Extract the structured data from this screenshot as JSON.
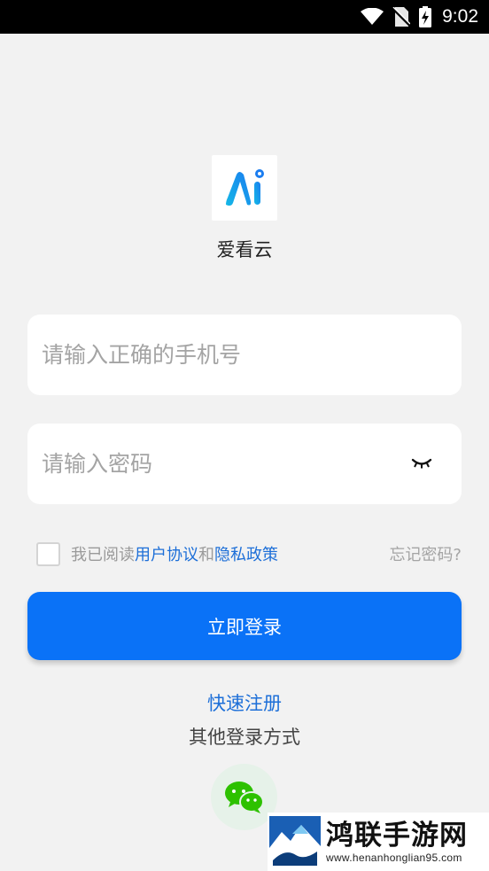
{
  "status_bar": {
    "time": "9:02",
    "icons": [
      "wifi-icon",
      "no-sim-icon",
      "battery-charging-icon"
    ]
  },
  "app": {
    "logo_icon": "ai-logo-icon",
    "name": "爱看云"
  },
  "phone_field": {
    "value": "",
    "placeholder": "请输入正确的手机号"
  },
  "password_field": {
    "value": "",
    "placeholder": "请输入密码",
    "toggle_icon": "eye-closed-icon"
  },
  "agreement": {
    "checked": false,
    "prefix": "我已阅读",
    "user_agreement": "用户协议",
    "conjunction": "和",
    "privacy_policy": "隐私政策",
    "forgot_password": "忘记密码?"
  },
  "login_button": {
    "label": "立即登录"
  },
  "register_link": "快速注册",
  "other_login": {
    "title": "其他登录方式",
    "methods": [
      "wechat-icon"
    ]
  },
  "watermark": {
    "title": "鸿联手游网",
    "url": "www.henanhonglian95.com"
  },
  "colors": {
    "accent": "#0a72f7",
    "link": "#1d6fd8",
    "background": "#f2f2f2",
    "wechat": "#2dc100"
  }
}
